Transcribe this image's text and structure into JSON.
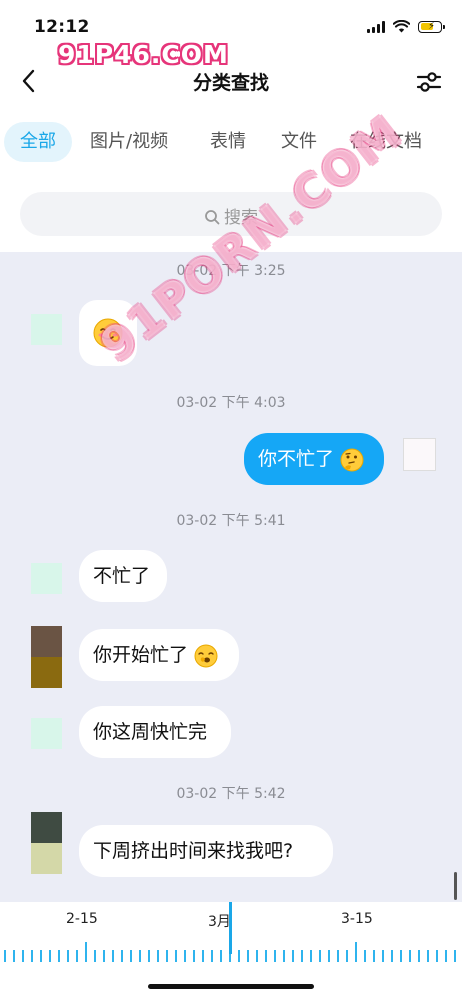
{
  "status_bar": {
    "time": "12:12"
  },
  "watermark": {
    "top_text": "91P46.COM",
    "diagonal_text": "91PORN.COM"
  },
  "nav": {
    "title": "分类查找"
  },
  "tabs": [
    {
      "label": "全部",
      "active": true
    },
    {
      "label": "图片/视频",
      "active": false
    },
    {
      "label": "表情",
      "active": false
    },
    {
      "label": "文件",
      "active": false
    },
    {
      "label": "在线文档",
      "active": false
    }
  ],
  "search": {
    "placeholder": "搜索"
  },
  "messages": [
    {
      "type": "timestamp",
      "text": "03-02 下午 3:25"
    },
    {
      "type": "received",
      "text": "",
      "emoji": "smiling-blush-emoji"
    },
    {
      "type": "timestamp",
      "text": "03-02 下午 4:03"
    },
    {
      "type": "sent",
      "text": "你不忙了",
      "emoji": "thinking-face-emoji"
    },
    {
      "type": "timestamp",
      "text": "03-02 下午 5:41"
    },
    {
      "type": "received",
      "text": "不忙了"
    },
    {
      "type": "received",
      "text": "你开始忙了",
      "emoji": "yawning-face-emoji"
    },
    {
      "type": "received",
      "text": "你这周快忙完"
    },
    {
      "type": "timestamp",
      "text": "03-02 下午 5:42"
    },
    {
      "type": "received",
      "text": "下周挤出时间来找我吧?"
    }
  ],
  "timeline": {
    "labels": [
      "2-15",
      "3月",
      "3-15"
    ]
  },
  "colors": {
    "accent": "#1aa7e8",
    "sent_bubble": "#15a7f6",
    "chat_bg": "#ebedf6"
  }
}
